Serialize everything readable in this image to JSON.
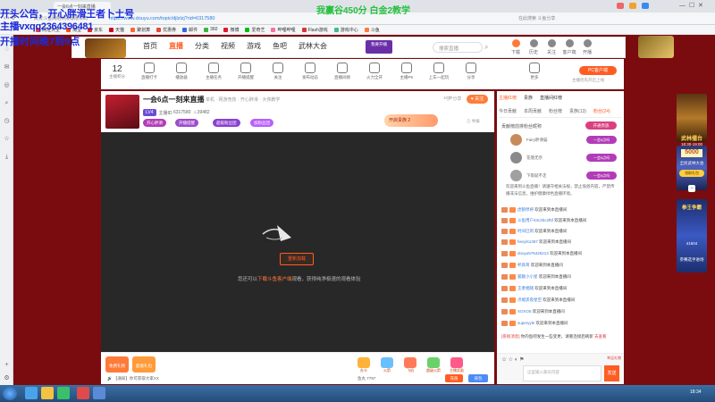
{
  "overlay": {
    "line1": "开头公告，开心胖滑王者卜土号",
    "line2": "主播vxqq2364396481",
    "line3": "开播时间晚7到9点",
    "score": "我赢谷450分 白金2教学"
  },
  "browser": {
    "tab_title": "一会6点一刻来直播",
    "url": "https://www.douyu.com/topic/djlzlzj?rid=6317580",
    "url_prefix": "武汉斗鱼网络科技有限公司",
    "search_hint": "在此搜索 斗鱼分享",
    "bookmarks": [
      "网址大全",
      "淘宝",
      "京东",
      "天猫",
      "聚划算",
      "优惠券",
      "邮件",
      "360",
      "微博",
      "爱奇艺",
      "哔哩哔哩",
      "Flash游戏",
      "游戏中心",
      "斗鱼"
    ]
  },
  "douyu": {
    "nav": [
      {
        "label": "首页",
        "active": false
      },
      {
        "label": "直播",
        "active": true
      },
      {
        "label": "分类",
        "active": false
      },
      {
        "label": "视频",
        "active": false
      },
      {
        "label": "游戏",
        "active": false
      },
      {
        "label": "鱼吧",
        "active": false
      },
      {
        "label": "武林大会",
        "active": false
      }
    ],
    "live_btn": "我要开播",
    "search_placeholder": "搜索直播",
    "header_icons": [
      "下载",
      "历史",
      "关注",
      "客户端",
      "开播"
    ]
  },
  "toolbar": {
    "level_num": "12",
    "level_label": "主播积分",
    "items": [
      "直播打卡",
      "播放器",
      "主播任务",
      "开播提醒",
      "关注",
      "发布动态",
      "直播间榜",
      "火力全开",
      "主播PK",
      "上车一起玩",
      "分享",
      "更多"
    ],
    "pc_btn": "PC客户端",
    "pc_sub": "主播优先开启上线"
  },
  "stream": {
    "title": "一会6点一刻来直播",
    "category": "单机 · 网游竞技 · 开心胖滑 · 大侠教学",
    "host_id": "6317580",
    "host_label": "主播ID",
    "heat": "39482",
    "tags": [
      {
        "label": "LV4",
        "color": "#7b5cf0"
      },
      {
        "label": "开心胖滑",
        "color": "#b23cb8"
      },
      {
        "label": "开播提醒",
        "color": "#9c4ccc"
      },
      {
        "label": "超级粉丝团",
        "color": "#8b40d0"
      },
      {
        "label": "加粉丝团",
        "color": "#b760ff"
      }
    ],
    "share": "分享",
    "follow_count": "1000",
    "follow_label": "关注",
    "gift_banner": "开启贵族 2",
    "report": "举报"
  },
  "player": {
    "retry": "重新加载",
    "tip_prefix": "您还可以",
    "tip_link": "下载斗鱼客户端",
    "tip_suffix": "观看，获得纯净极速的观看体验"
  },
  "giftbar": {
    "btns": [
      {
        "label": "免费礼物",
        "color": "#ff7b3a"
      },
      {
        "label": "超值礼包",
        "color": "#ff9b3a"
      }
    ],
    "gifts": [
      "办卡",
      "火箭",
      "飞机",
      "超级火箭",
      "主播奖励"
    ],
    "ad": "【通知】你可获取大家XX",
    "balance": "鱼丸 7797",
    "recharge": "充值",
    "package": "背包"
  },
  "chat": {
    "tabs_top": [
      "主播红榜",
      "贵族",
      "直播间红榜"
    ],
    "tabs": [
      "今日贡献",
      "本周贡献",
      "粉丝榜",
      "贵族(13)",
      "粉丝(24)"
    ],
    "rank_title": "贡献榜前排粉丝昵称",
    "rank_btn": "开通贵族",
    "ranks": [
      {
        "name": "Fairy胖滑猫",
        "badge": "一会6点吗"
      },
      {
        "name": "花落无奈",
        "badge": "一会6点吗"
      },
      {
        "name": "下雨就不走",
        "badge": "一会6点吗"
      }
    ],
    "notice": "欢迎来到斗鱼直播！请遵守相关法规，禁止低俗内容，严禁传播非法信息，维护健康绿色直播环境。",
    "messages": [
      {
        "user": "虎狼悍将",
        "text": "欢迎来到本直播间"
      },
      {
        "user": "斗鱼用户43c2bc2f6f",
        "text": "欢迎来到本直播间"
      },
      {
        "user": "时间已到",
        "text": "欢迎来到本直播间"
      },
      {
        "user": "hexyls1387",
        "text": "欢迎来到本直播间"
      },
      {
        "user": "douyu576426213",
        "text": "欢迎来到本直播间"
      },
      {
        "user": "杯具哥",
        "text": "欢迎来到本直播间"
      },
      {
        "user": "狐魅小小星",
        "text": "欢迎来到本直播间"
      },
      {
        "user": "王者相随",
        "text": "欢迎来到本直播间"
      },
      {
        "user": "点缀黑夜星空",
        "text": "欢迎来到本直播间"
      },
      {
        "user": "XOXO5",
        "text": "欢迎来到本直播间"
      },
      {
        "user": "superyyle",
        "text": "欢迎来到本直播间"
      }
    ],
    "sys_label": "[系统消息]",
    "sys_text": "你的鱼吧发生一些变更，请重连接后刷新",
    "sys_link": "去查看",
    "input_placeholder": "这里输入聊天内容",
    "send": "发送",
    "lucky": "幸运礼物"
  },
  "right_ads": {
    "ad1": "武林擂台",
    "ad1_time": "18:30-19:00",
    "ad1_num": "5000",
    "ad1_gift": "领取礼包",
    "ad2": "全民武林大会",
    "ad3_title": "拳王争霸",
    "ad3_count": "41604",
    "ad3_desc": "参赛选手进场"
  },
  "taskbar": {
    "clock": "18:34"
  }
}
